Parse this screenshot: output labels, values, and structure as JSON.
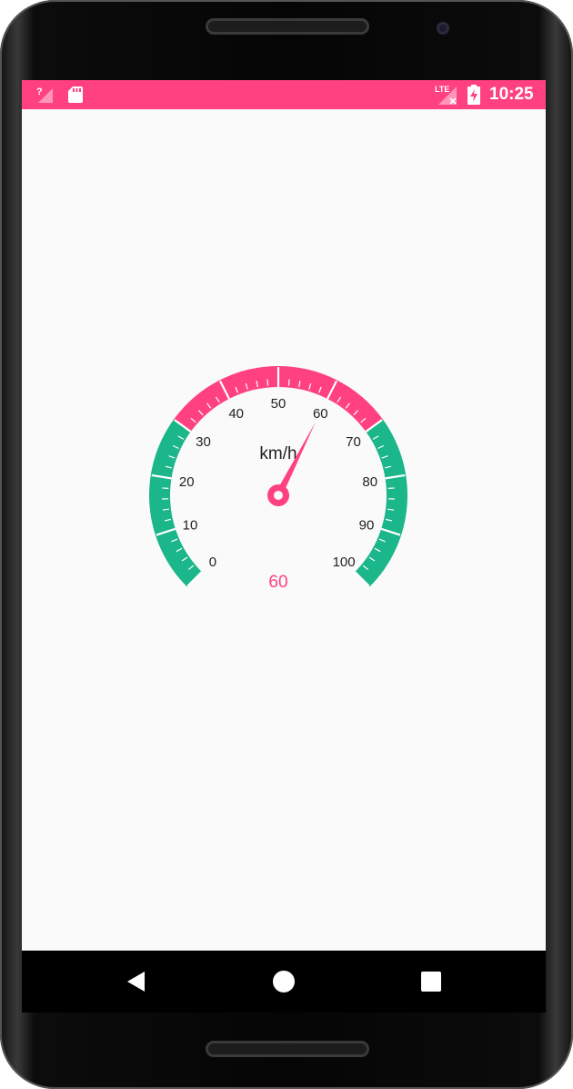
{
  "status_bar": {
    "time": "10:25",
    "network_label": "LTE",
    "icons": [
      "signal-unknown-icon",
      "sd-card-icon",
      "lte-signal-icon",
      "battery-charging-icon"
    ],
    "color": "#ff4081"
  },
  "gauge": {
    "unit": "km/h",
    "value": 60,
    "value_label": "60",
    "min": 0,
    "max": 100,
    "tick_labels": [
      "0",
      "10",
      "20",
      "30",
      "40",
      "50",
      "60",
      "70",
      "80",
      "90",
      "100"
    ],
    "start_angle_deg": 225,
    "sweep_deg": 270,
    "sections": [
      {
        "from": 0,
        "to": 30,
        "color": "#1cb68b"
      },
      {
        "from": 30,
        "to": 70,
        "color": "#ff4081"
      },
      {
        "from": 70,
        "to": 100,
        "color": "#1cb68b"
      }
    ],
    "needle_color": "#ff4081",
    "text_color": "#222222",
    "value_color": "#ff4081"
  },
  "nav_bar": {
    "buttons": [
      "back-icon",
      "home-icon",
      "recents-icon"
    ]
  }
}
